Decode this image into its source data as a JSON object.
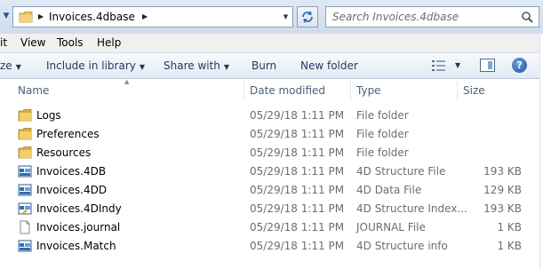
{
  "address": {
    "folder_name": "Invoices.4dbase",
    "search_placeholder": "Search Invoices.4dbase"
  },
  "menu": [
    "it",
    "View",
    "Tools",
    "Help"
  ],
  "commands": {
    "organize": "ze",
    "include_in_library": "Include in library",
    "share_with": "Share with",
    "burn": "Burn",
    "new_folder": "New folder"
  },
  "columns": {
    "name": "Name",
    "date_modified": "Date modified",
    "type": "Type",
    "size": "Size"
  },
  "files": [
    {
      "name": "Logs",
      "date": "05/29/18 1:11 PM",
      "type": "File folder",
      "size": "",
      "icon": "folder-icon"
    },
    {
      "name": "Preferences",
      "date": "05/29/18 1:11 PM",
      "type": "File folder",
      "size": "",
      "icon": "folder-icon"
    },
    {
      "name": "Resources",
      "date": "05/29/18 1:11 PM",
      "type": "File folder",
      "size": "",
      "icon": "folder-icon"
    },
    {
      "name": "Invoices.4DB",
      "date": "05/29/18 1:11 PM",
      "type": "4D Structure File",
      "size": "193 KB",
      "icon": "4d-file-icon"
    },
    {
      "name": "Invoices.4DD",
      "date": "05/29/18 1:11 PM",
      "type": "4D Data File",
      "size": "129 KB",
      "icon": "4d-file-icon"
    },
    {
      "name": "Invoices.4DIndy",
      "date": "05/29/18 1:11 PM",
      "type": "4D Structure Index...",
      "size": "193 KB",
      "icon": "4d-index-icon"
    },
    {
      "name": "Invoices.journal",
      "date": "05/29/18 1:11 PM",
      "type": "JOURNAL File",
      "size": "1 KB",
      "icon": "document-icon"
    },
    {
      "name": "Invoices.Match",
      "date": "05/29/18 1:11 PM",
      "type": "4D Structure info",
      "size": "1 KB",
      "icon": "4d-file-icon"
    }
  ]
}
